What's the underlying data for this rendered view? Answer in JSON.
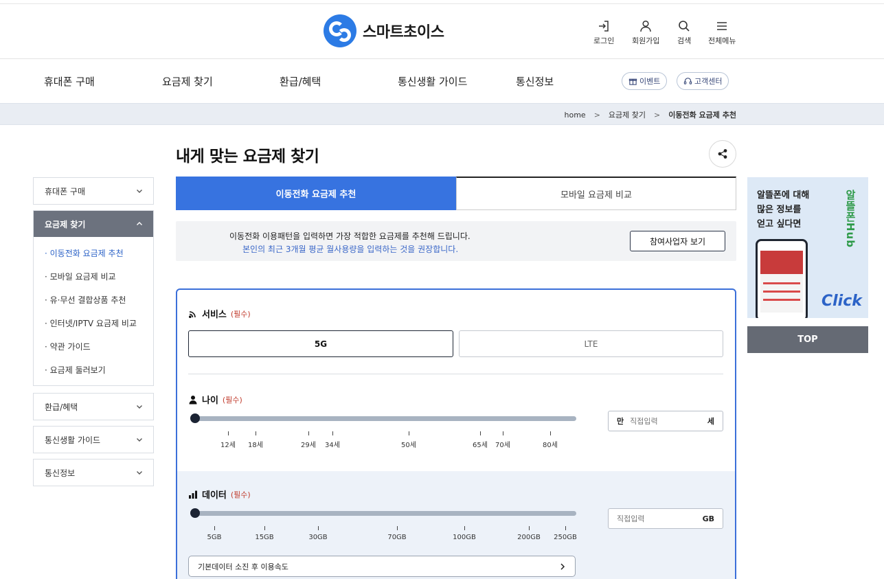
{
  "header": {
    "logo_text": "스마트초이스",
    "utils": [
      {
        "label": "로그인",
        "icon": "login-icon"
      },
      {
        "label": "회원가입",
        "icon": "user-icon"
      },
      {
        "label": "검색",
        "icon": "search-icon"
      },
      {
        "label": "전체메뉴",
        "icon": "menu-icon"
      }
    ]
  },
  "gnb": {
    "items": [
      "휴대폰 구매",
      "요금제 찾기",
      "환급/혜택",
      "통신생활 가이드",
      "통신정보"
    ],
    "pills": [
      "이벤트",
      "고객센터"
    ]
  },
  "breadcrumb": {
    "items": [
      "home",
      "요금제 찾기",
      "이동전화 요금제 추천"
    ]
  },
  "lnb": {
    "groups": [
      {
        "label": "휴대폰 구매"
      },
      {
        "label": "요금제 찾기",
        "active": true,
        "sub": [
          "· 이동전화 요금제 추천",
          "· 모바일 요금제 비교",
          "· 유·무선 결합상품 추천",
          "· 인터넷/IPTV 요금제 비교",
          "· 약관 가이드",
          "· 요금제 둘러보기"
        ]
      },
      {
        "label": "환급/혜택"
      },
      {
        "label": "통신생활 가이드"
      },
      {
        "label": "통신정보"
      }
    ]
  },
  "main": {
    "title": "내게 맞는 요금제 찾기",
    "tabs": [
      "이동전화 요금제 추천",
      "모바일 요금제 비교"
    ],
    "notice": {
      "line1": "이동전화 이용패턴을 입력하면 가장 적합한 요금제를 추천해 드립니다.",
      "line2": "본인의 최근 3개월 평균 월사용량을 입력하는 것을 권장합니다.",
      "button": "참여사업자 보기"
    },
    "service": {
      "label": "서비스",
      "required": "(필수)",
      "options": [
        "5G",
        "LTE"
      ],
      "selected": "5G"
    },
    "age": {
      "label": "나이",
      "required": "(필수)",
      "ticks": [
        "12세",
        "18세",
        "29세",
        "34세",
        "50세",
        "65세",
        "70세",
        "80세"
      ],
      "input_prefix": "만",
      "input_placeholder": "직접입력",
      "input_unit": "세"
    },
    "data": {
      "label": "데이터",
      "required": "(필수)",
      "ticks": [
        "5GB",
        "15GB",
        "30GB",
        "70GB",
        "100GB",
        "200GB",
        "250GB"
      ],
      "input_placeholder": "직접입력",
      "input_unit": "GB",
      "speed_select": "기본데이터 소진 후 이용속도"
    }
  },
  "aside": {
    "banner_text": [
      "알뜰폰에 대해",
      "많은 정보를",
      "얻고 싶다면"
    ],
    "banner_brand": "알뜰폰Hub",
    "banner_cta": "Click",
    "top_button": "TOP"
  },
  "colors": {
    "accent": "#3773e0",
    "lnb_active": "#6c727e",
    "required": "#c03a2b",
    "notice_blue": "#3a67c8"
  }
}
